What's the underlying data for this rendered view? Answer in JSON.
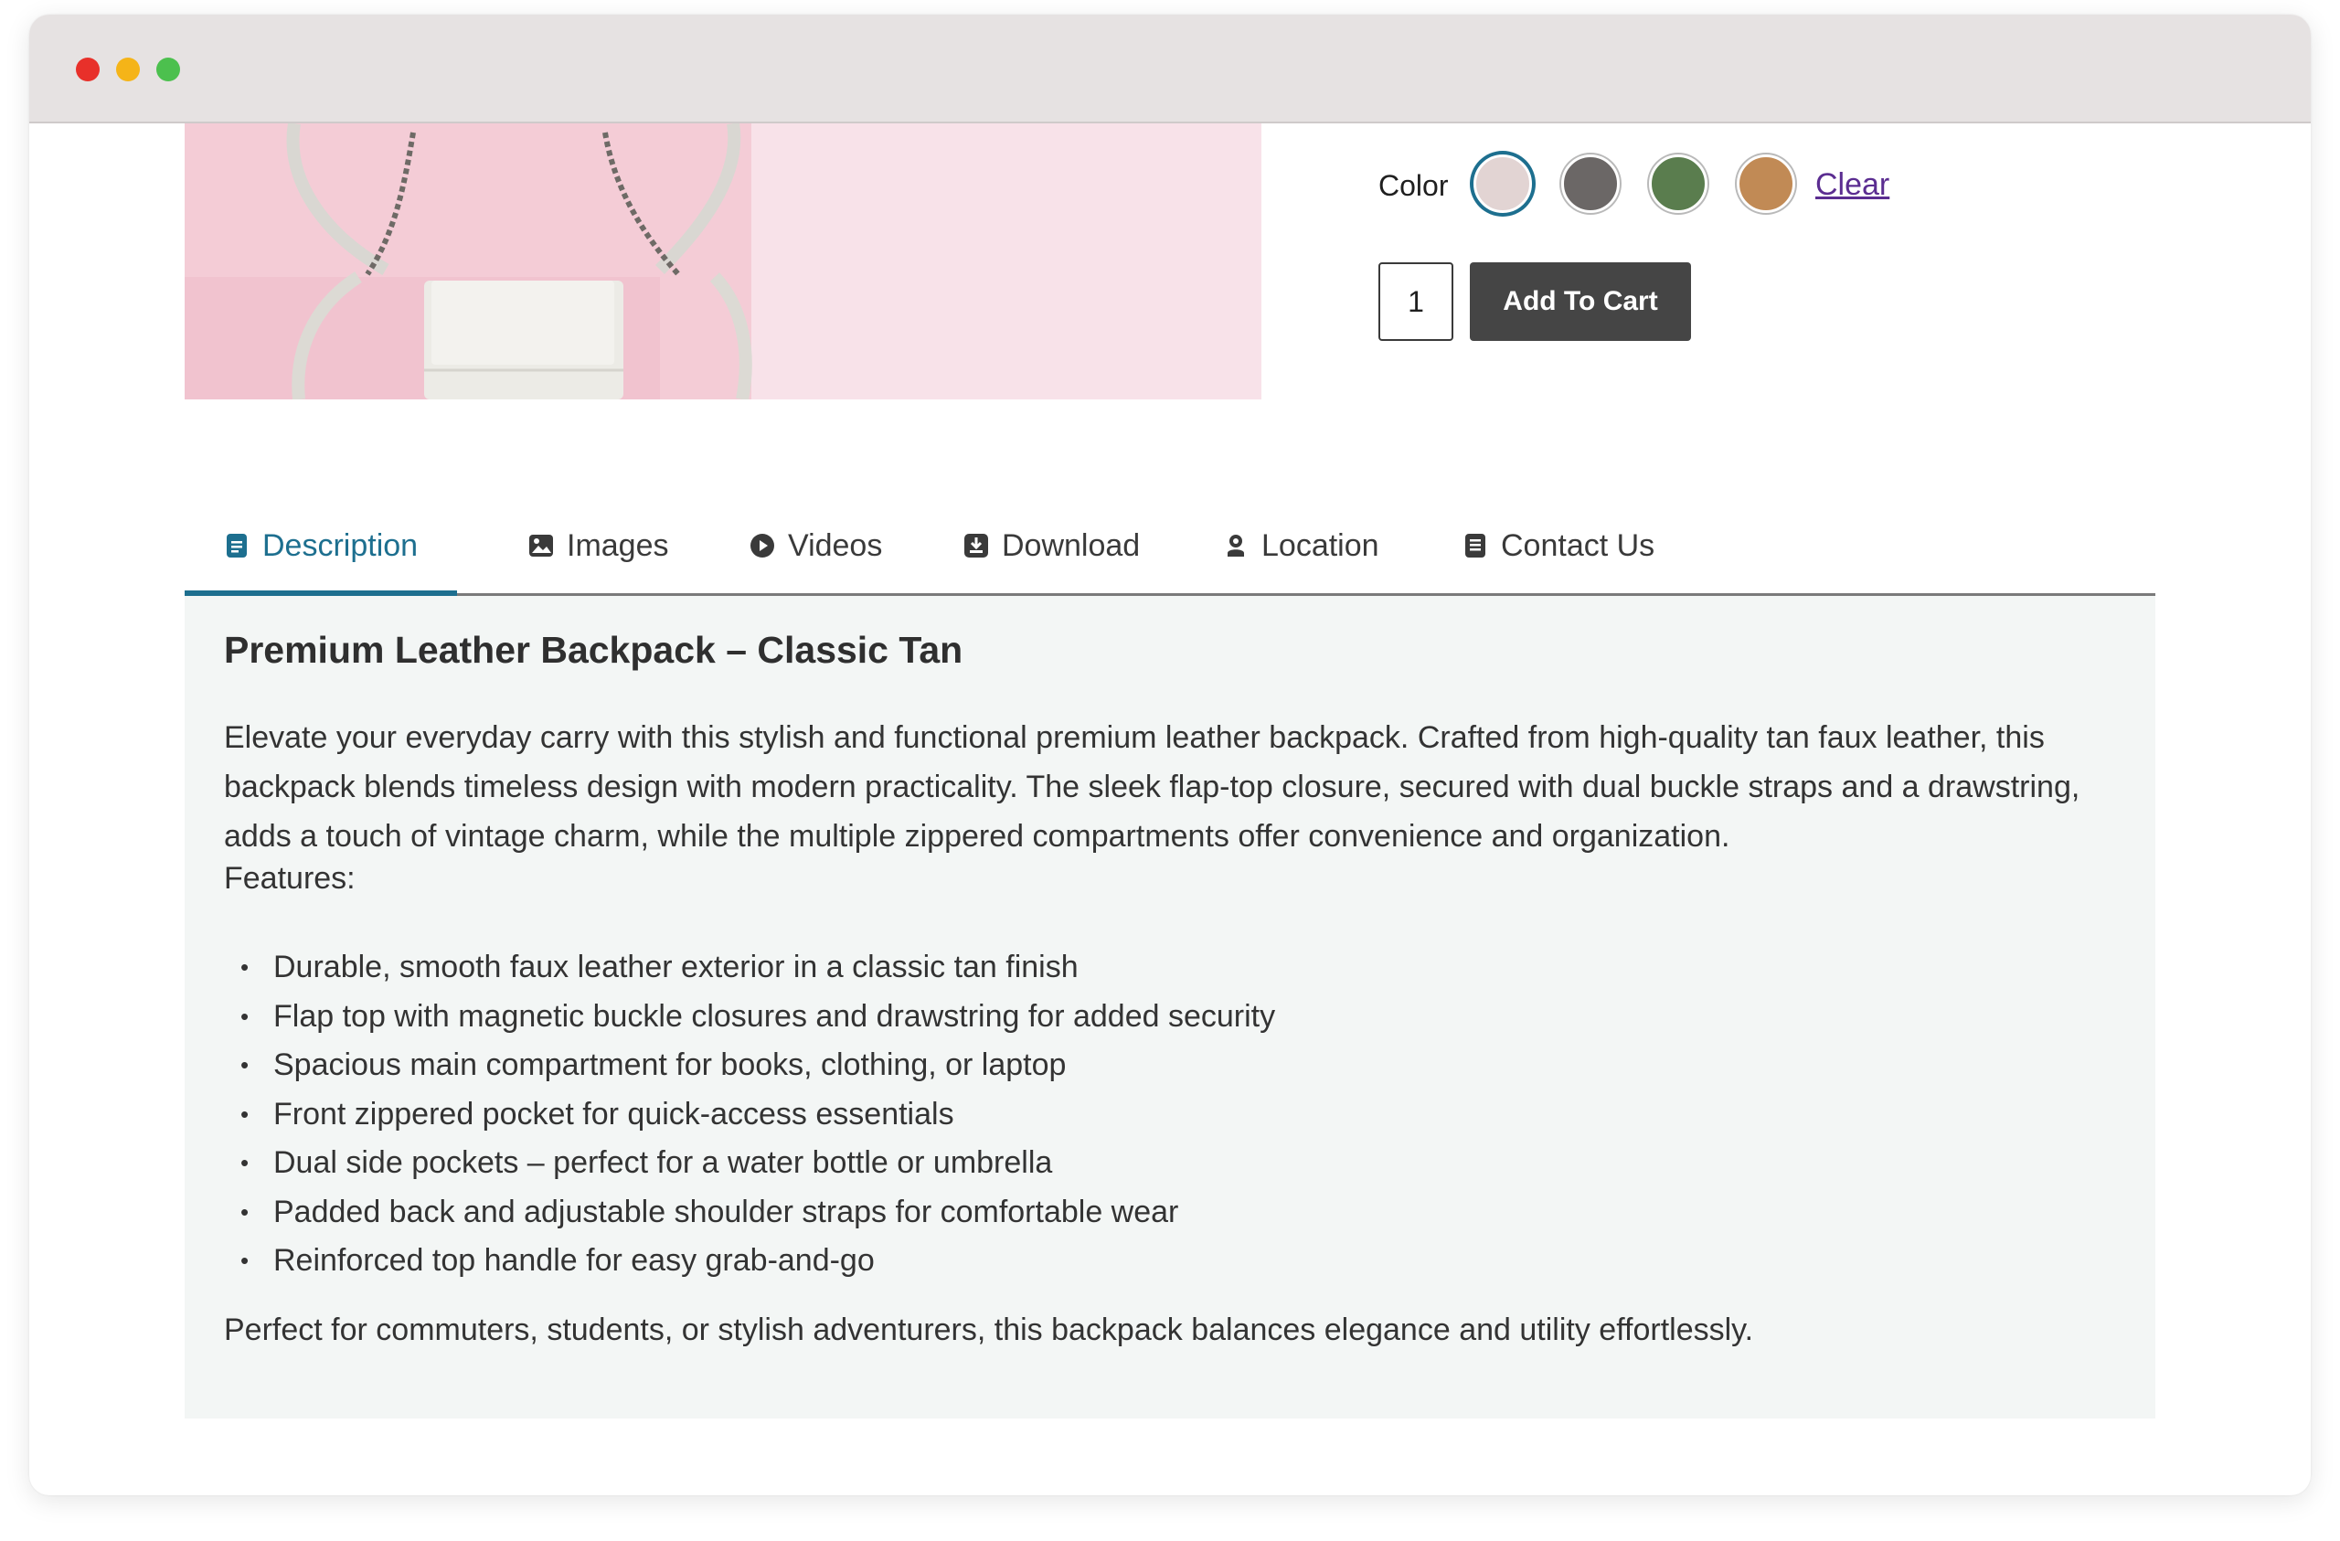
{
  "window": {
    "controls": [
      "close",
      "minimize",
      "maximize"
    ]
  },
  "product": {
    "image_icon": "backpack-photo",
    "color": {
      "label": "Color",
      "swatches": [
        {
          "name": "blush",
          "hex": "#e2d4d3",
          "selected": true
        },
        {
          "name": "slate",
          "hex": "#6b6766",
          "selected": false
        },
        {
          "name": "green",
          "hex": "#5a7d4e",
          "selected": false
        },
        {
          "name": "tan",
          "hex": "#c18a55",
          "selected": false
        }
      ],
      "clear_label": "Clear"
    },
    "quantity": "1",
    "add_to_cart_label": "Add To Cart"
  },
  "tabs": [
    {
      "label": "Description",
      "icon": "document-icon",
      "active": true
    },
    {
      "label": "Images",
      "icon": "image-icon",
      "active": false
    },
    {
      "label": "Videos",
      "icon": "play-icon",
      "active": false
    },
    {
      "label": "Download",
      "icon": "download-icon",
      "active": false
    },
    {
      "label": "Location",
      "icon": "location-icon",
      "active": false
    },
    {
      "label": "Contact Us",
      "icon": "contact-icon",
      "active": false
    }
  ],
  "description": {
    "title": "Premium Leather Backpack – Classic Tan",
    "body": "Elevate your everyday carry with this stylish and functional premium leather backpack. Crafted from high-quality tan faux leather, this backpack blends timeless design with modern practicality. The sleek flap-top closure, secured with dual buckle straps and a drawstring, adds a touch of vintage charm, while the multiple zippered compartments offer convenience and organization.",
    "features_label": "Features:",
    "features": [
      "Durable, smooth faux leather exterior in a classic tan finish",
      "Flap top with magnetic buckle closures and drawstring for added security",
      "Spacious main compartment for books, clothing, or laptop",
      "Front zippered pocket for quick-access essentials",
      "Dual side pockets – perfect for a water bottle or umbrella",
      "Padded back and adjustable shoulder straps for comfortable wear",
      "Reinforced top handle for easy grab-and-go"
    ],
    "closing": "Perfect for commuters, students, or stylish adventurers, this backpack balances elegance and utility effortlessly."
  },
  "colors": {
    "accent": "#1d6f8f",
    "button_bg": "#454545",
    "panel_bg": "#f3f6f5",
    "link": "#5b2d91"
  }
}
